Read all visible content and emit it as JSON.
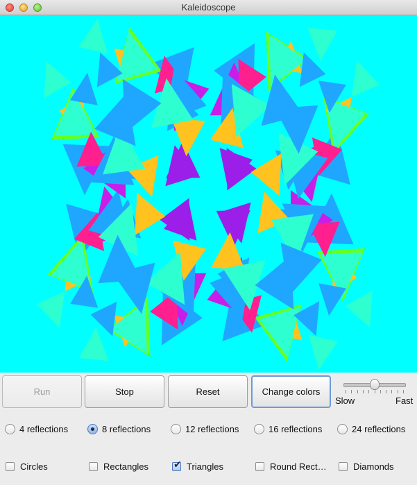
{
  "window": {
    "title": "Kaleidoscope"
  },
  "buttons": {
    "run": {
      "label": "Run",
      "enabled": false
    },
    "stop": {
      "label": "Stop"
    },
    "reset": {
      "label": "Reset"
    },
    "change_colors": {
      "label": "Change colors"
    }
  },
  "speed": {
    "slow_label": "Slow",
    "fast_label": "Fast",
    "value_fraction": 0.5
  },
  "reflections": {
    "options": [
      "4 reflections",
      "8 reflections",
      "12 reflections",
      "16 reflections",
      "24 reflections"
    ],
    "selected": "8 reflections"
  },
  "shapes": {
    "options": [
      {
        "label": "Circles",
        "checked": false
      },
      {
        "label": "Rectangles",
        "checked": false
      },
      {
        "label": "Triangles",
        "checked": true
      },
      {
        "label": "Round Rect…",
        "checked": false
      },
      {
        "label": "Diamonds",
        "checked": false
      }
    ]
  },
  "colors": {
    "canvas_bg": "#00ffff",
    "palette": [
      "#ff1f8e",
      "#c71fe8",
      "#3d1fe8",
      "#66ff1f",
      "#ffc21f",
      "#1fa7ff",
      "#ff1f55",
      "#9b1fe8",
      "#ff6a1f",
      "#2effd0"
    ]
  }
}
